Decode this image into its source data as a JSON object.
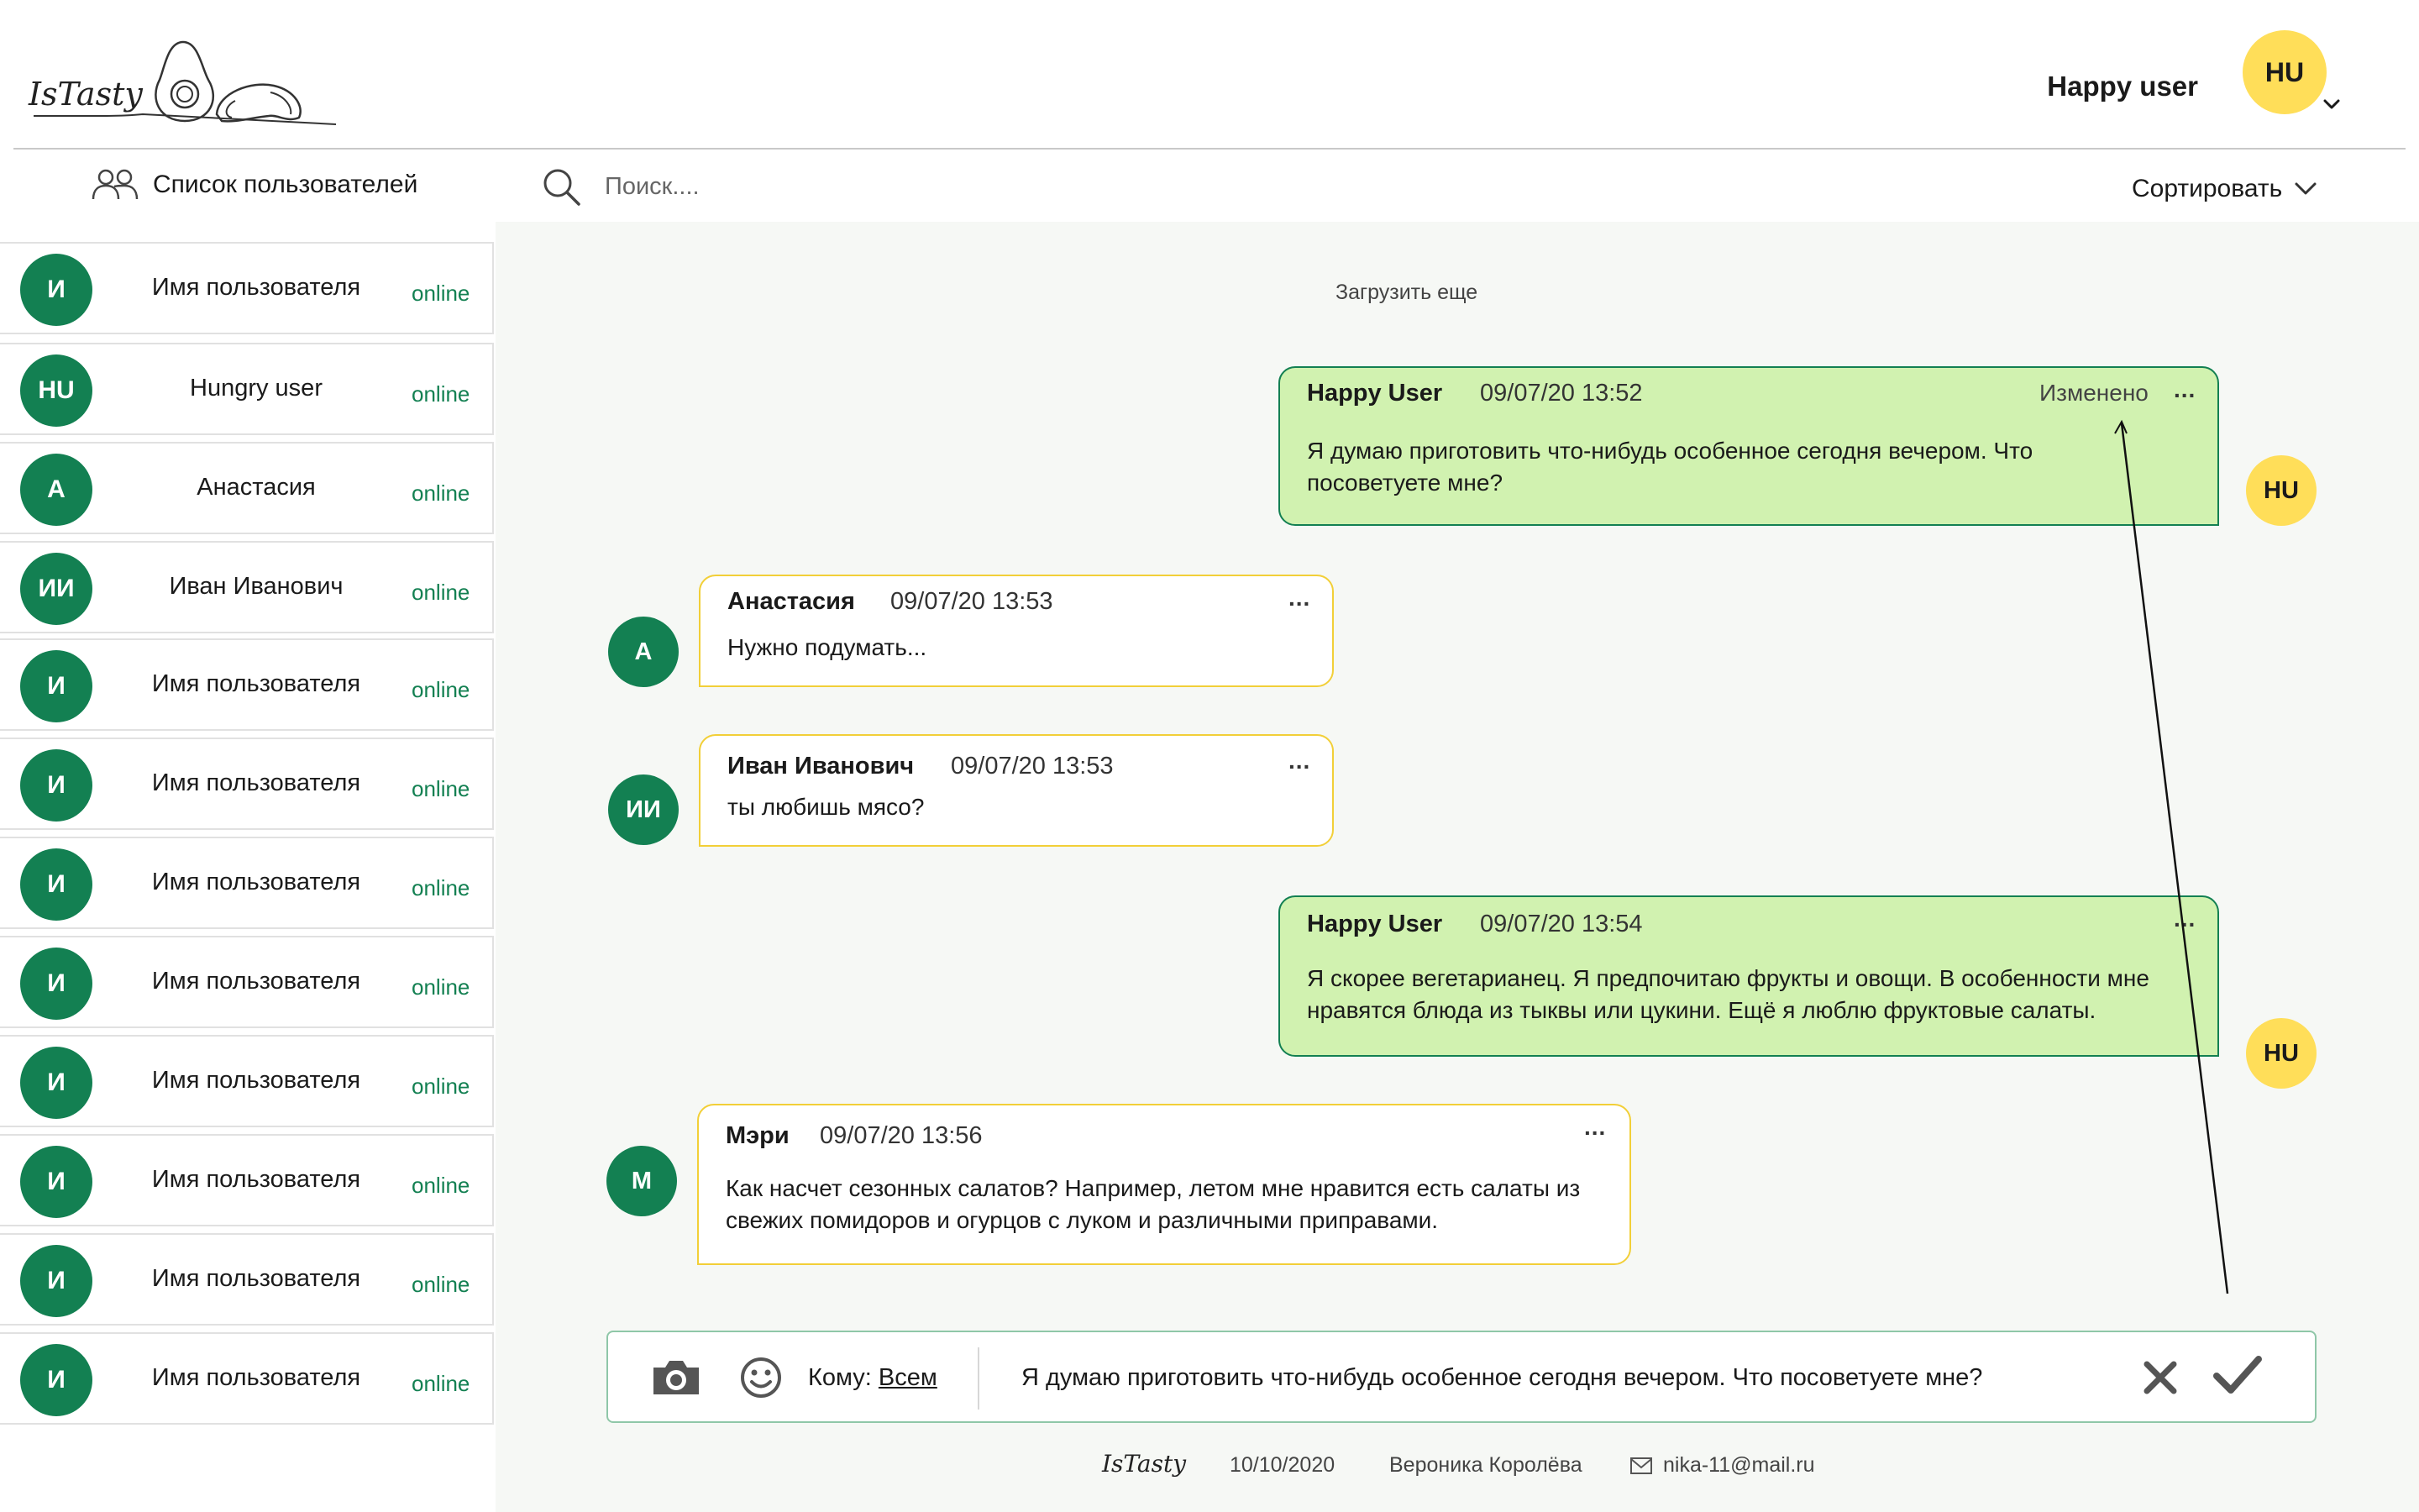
{
  "header": {
    "logo_text": "IsTasty",
    "user_name": "Happy user",
    "user_initials": "HU"
  },
  "toolbar": {
    "users_list_label": "Список пользователей",
    "search_placeholder": "Поиск....",
    "sort_label": "Сортировать"
  },
  "sidebar": {
    "users": [
      {
        "initials": "И",
        "name": "Имя пользователя",
        "status": "online"
      },
      {
        "initials": "HU",
        "name": "Hungry user",
        "status": "online"
      },
      {
        "initials": "А",
        "name": "Анастасия",
        "status": "online"
      },
      {
        "initials": "ИИ",
        "name": "Иван Иванович",
        "status": "online"
      },
      {
        "initials": "И",
        "name": "Имя пользователя",
        "status": "online"
      },
      {
        "initials": "И",
        "name": "Имя пользователя",
        "status": "online"
      },
      {
        "initials": "И",
        "name": "Имя пользователя",
        "status": "online"
      },
      {
        "initials": "И",
        "name": "Имя пользователя",
        "status": "online"
      },
      {
        "initials": "И",
        "name": "Имя пользователя",
        "status": "online"
      },
      {
        "initials": "И",
        "name": "Имя пользователя",
        "status": "online"
      },
      {
        "initials": "И",
        "name": "Имя пользователя",
        "status": "online"
      },
      {
        "initials": "И",
        "name": "Имя пользователя",
        "status": "online"
      }
    ]
  },
  "chat": {
    "load_more": "Загрузить еще",
    "messages": [
      {
        "author": "Happy User",
        "time": "09/07/20 13:52",
        "edited": "Изменено",
        "more": "...",
        "text": "Я думаю приготовить что-нибудь особенное сегодня вечером. Что посоветуете мне?",
        "initials": "HU"
      },
      {
        "author": "Анастасия",
        "time": "09/07/20 13:53",
        "more": "...",
        "text": "Нужно подумать...",
        "initials": "А"
      },
      {
        "author": "Иван Иванович",
        "time": "09/07/20 13:53",
        "more": "...",
        "text": "ты любишь  мясо?",
        "initials": "ИИ"
      },
      {
        "author": "Happy User",
        "time": "09/07/20 13:54",
        "more": "...",
        "text": "Я скорее вегетарианец. Я предпочитаю фрукты и овощи. В особенности мне нравятся блюда из тыквы или цукини. Ещё я люблю фруктовые салаты.",
        "initials": "HU"
      },
      {
        "author": "Мэри",
        "time": "09/07/20 13:56",
        "more": "...",
        "text": "Как насчет сезонных салатов? Например, летом мне нравится есть салаты из свежих помидоров и огурцов с луком и различными приправами.",
        "initials": "М"
      }
    ]
  },
  "composer": {
    "to_label": "Кому:",
    "to_value": "Всем",
    "message": "Я думаю приготовить что-нибудь особенное сегодня вечером. Что посоветуете мне?"
  },
  "footer": {
    "logo_text": "IsTasty",
    "date": "10/10/2020",
    "author": "Вероника Королёва",
    "email": "nika-11@mail.ru"
  },
  "colors": {
    "brand_green": "#138052",
    "accent_yellow": "#ffde59",
    "own_bubble": "#d1f2b0",
    "other_bubble_border": "#f2cf38"
  },
  "icons": [
    "users-icon",
    "search-icon",
    "chevron-down-icon",
    "camera-icon",
    "smile-icon",
    "close-icon",
    "check-icon",
    "mail-icon"
  ]
}
